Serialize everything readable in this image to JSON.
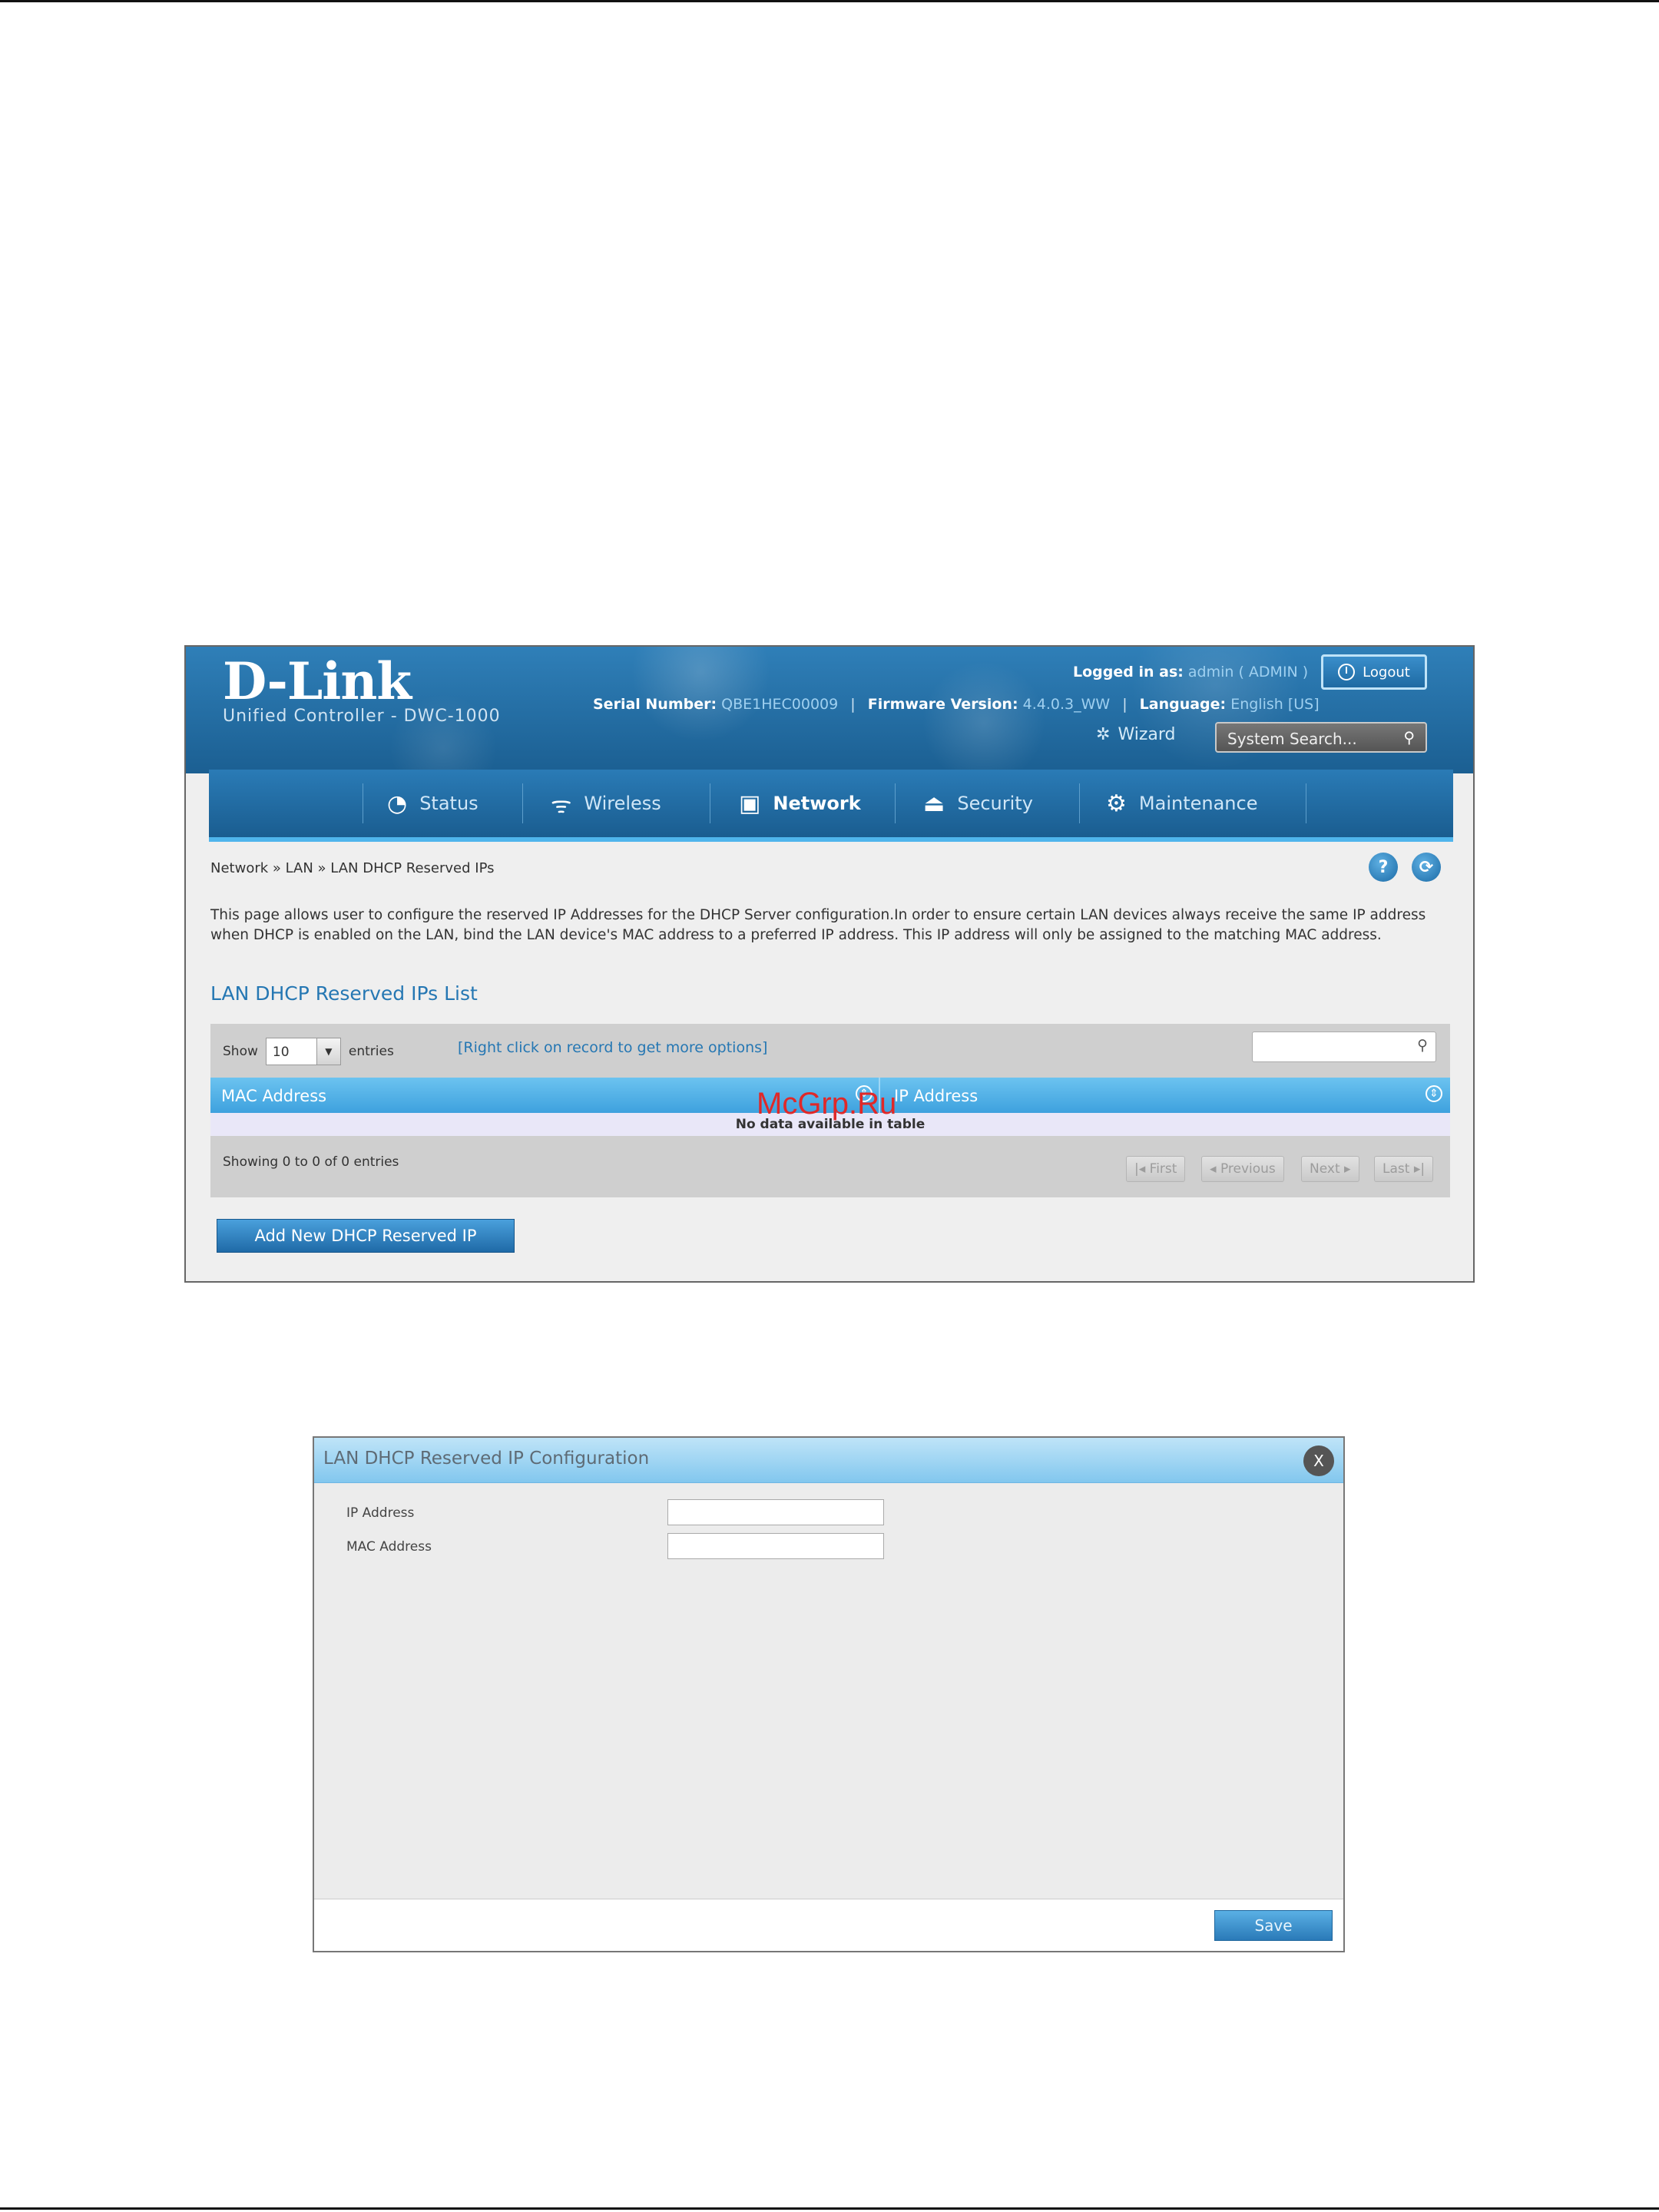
{
  "header": {
    "logo": "D-Link",
    "logo_sub": "Unified Controller - DWC-1000",
    "logged_in_label": "Logged in as:",
    "logged_in_value": "admin ( ADMIN )",
    "logout_label": "Logout",
    "serial_label": "Serial Number:",
    "serial_value": "QBE1HEC00009",
    "firmware_label": "Firmware Version:",
    "firmware_value": "4.4.0.3_WW",
    "language_label": "Language:",
    "language_value": "English [US]",
    "wizard_label": "Wizard",
    "search_placeholder": "System Search..."
  },
  "nav": {
    "items": [
      {
        "label": "Status",
        "icon": "dashboard-icon"
      },
      {
        "label": "Wireless",
        "icon": "wifi-icon"
      },
      {
        "label": "Network",
        "icon": "network-icon",
        "active": true
      },
      {
        "label": "Security",
        "icon": "lock-icon"
      },
      {
        "label": "Maintenance",
        "icon": "gear-icon"
      }
    ]
  },
  "breadcrumb": "Network  »  LAN  »  LAN DHCP Reserved IPs",
  "help_icon_label": "?",
  "description": "This page allows user to configure the reserved IP Addresses for the DHCP Server configuration.In order to ensure certain LAN devices always receive the same IP address when DHCP is enabled on the LAN, bind the LAN device's MAC address to a preferred IP address. This IP address will only be assigned to the matching MAC address.",
  "list": {
    "title": "LAN DHCP Reserved IPs List",
    "show_label": "Show",
    "show_value": "10",
    "entries_label": "entries",
    "right_click_hint": "[Right click on record to get more options]",
    "columns": [
      "MAC Address",
      "IP Address"
    ],
    "empty_text": "No data available in table",
    "showing_text": "Showing 0 to 0 of 0 entries",
    "pager": {
      "first": "First",
      "previous": "Previous",
      "next": "Next",
      "last": "Last"
    },
    "add_button": "Add New DHCP Reserved IP"
  },
  "watermark": "McGrp.Ru",
  "dialog": {
    "title": "LAN DHCP Reserved IP Configuration",
    "close_label": "X",
    "fields": [
      {
        "label": "IP Address",
        "value": ""
      },
      {
        "label": "MAC Address",
        "value": ""
      }
    ],
    "save_label": "Save"
  }
}
